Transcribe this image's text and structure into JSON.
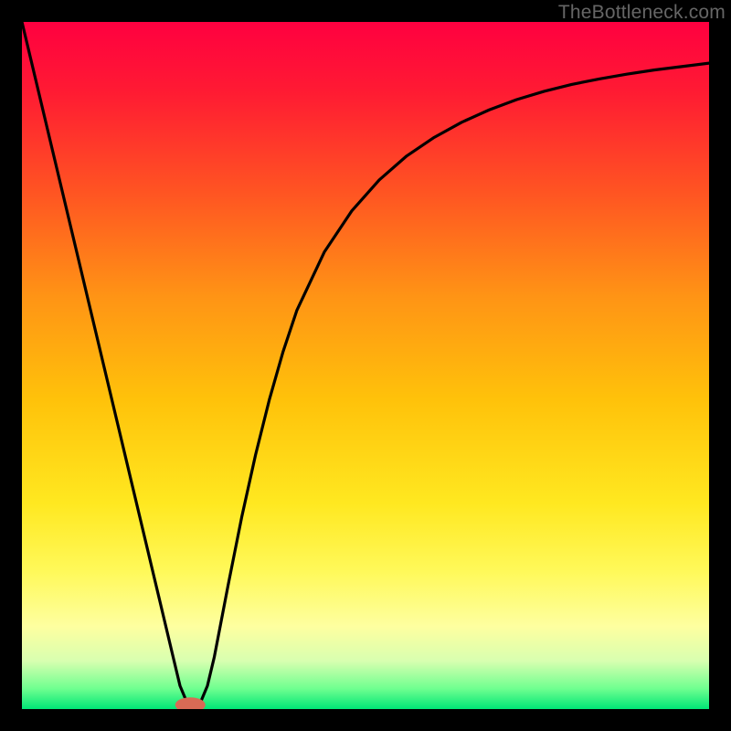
{
  "watermark": "TheBottleneck.com",
  "chart_data": {
    "type": "line",
    "title": "",
    "xlabel": "",
    "ylabel": "",
    "xlim": [
      0,
      100
    ],
    "ylim": [
      0,
      100
    ],
    "x": [
      0,
      2,
      4,
      6,
      8,
      10,
      12,
      14,
      16,
      18,
      20,
      22,
      23,
      24,
      25,
      26,
      27,
      28,
      30,
      32,
      34,
      36,
      38,
      40,
      44,
      48,
      52,
      56,
      60,
      64,
      68,
      72,
      76,
      80,
      84,
      88,
      92,
      96,
      100
    ],
    "y": [
      100,
      91.6,
      83.2,
      74.8,
      66.4,
      58.0,
      49.6,
      41.2,
      32.8,
      24.4,
      16.0,
      7.6,
      3.4,
      1.0,
      0.0,
      1.0,
      3.4,
      7.6,
      18.0,
      28.0,
      37.0,
      45.0,
      52.0,
      58.0,
      66.5,
      72.5,
      77.0,
      80.5,
      83.2,
      85.4,
      87.2,
      88.7,
      89.9,
      90.9,
      91.7,
      92.4,
      93.0,
      93.5,
      94.0
    ],
    "gradient_stops": [
      {
        "offset": 0.0,
        "color": "#ff0040"
      },
      {
        "offset": 0.1,
        "color": "#ff1a33"
      },
      {
        "offset": 0.25,
        "color": "#ff5522"
      },
      {
        "offset": 0.4,
        "color": "#ff9415"
      },
      {
        "offset": 0.55,
        "color": "#ffc20a"
      },
      {
        "offset": 0.7,
        "color": "#ffe820"
      },
      {
        "offset": 0.8,
        "color": "#fff95a"
      },
      {
        "offset": 0.88,
        "color": "#feffa0"
      },
      {
        "offset": 0.93,
        "color": "#d8ffb0"
      },
      {
        "offset": 0.97,
        "color": "#70ff90"
      },
      {
        "offset": 1.0,
        "color": "#00e676"
      }
    ],
    "marker": {
      "x": 24.5,
      "y": 0.6,
      "rx": 2.2,
      "ry": 1.1,
      "color": "#d96a55"
    }
  }
}
